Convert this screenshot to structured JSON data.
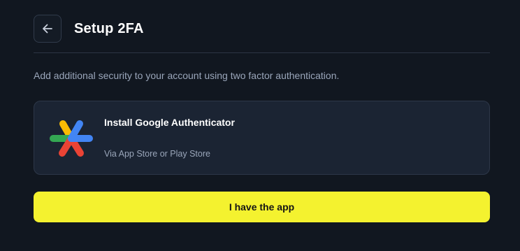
{
  "header": {
    "title": "Setup 2FA",
    "back_icon": "arrow-left-icon"
  },
  "description": "Add additional security to your account using two factor authentication.",
  "authenticator_card": {
    "icon": "google-authenticator-icon",
    "title": "Install Google Authenticator",
    "subtitle": "Via App Store or Play Store"
  },
  "primary_button": {
    "label": "I have the app"
  },
  "colors": {
    "background": "#111720",
    "card_background": "#1b2433",
    "accent": "#f4f22f",
    "muted_text": "#9aa6ba",
    "logo_yellow": "#fbbc04",
    "logo_green": "#34a853",
    "logo_red": "#ea4335",
    "logo_blue": "#4285f4"
  }
}
